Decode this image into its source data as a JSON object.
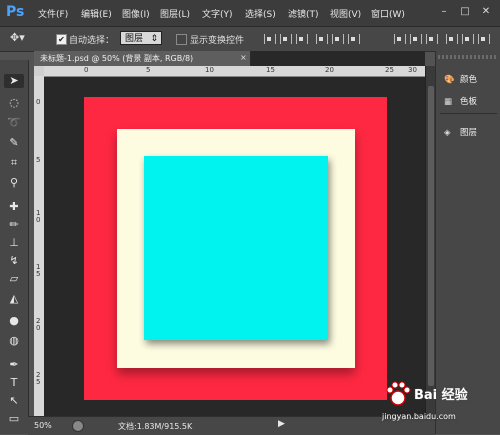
{
  "app": {
    "logo": "Ps"
  },
  "menu": [
    "文件(F)",
    "编辑(E)",
    "图像(I)",
    "图层(L)",
    "文字(Y)",
    "选择(S)",
    "滤镜(T)",
    "视图(V)",
    "窗口(W)"
  ],
  "window_controls": [
    "–",
    "□",
    "✕"
  ],
  "options": {
    "auto_select_label": "自动选择：",
    "auto_select_checked": "✔",
    "layer_select_value": "图层",
    "show_transform_label": "显示变换控件"
  },
  "document": {
    "tab_title": "未标题-1.psd @ 50% (背景 副本, RGB/8)",
    "close": "×",
    "ruler_h_labels": [
      "0",
      "5",
      "10",
      "15",
      "20",
      "25",
      "30"
    ],
    "ruler_v_labels": [
      "0",
      "5",
      "1 0",
      "1 5",
      "2 0",
      "2 5"
    ]
  },
  "status": {
    "zoom": "50%",
    "doc_info": "文档:1.83M/915.5K",
    "arrow": "▶"
  },
  "panels": [
    {
      "label": "颜色",
      "icon": "palette-icon"
    },
    {
      "label": "色板",
      "icon": "swatches-icon"
    },
    {
      "label": "图层",
      "icon": "layers-icon"
    }
  ],
  "watermark": {
    "brand": "Bai 经验",
    "url": "jingyan.baidu.com"
  },
  "colors": {
    "outer": "#ff2842",
    "middle": "#fdfce1",
    "inner": "#00f3ee"
  }
}
